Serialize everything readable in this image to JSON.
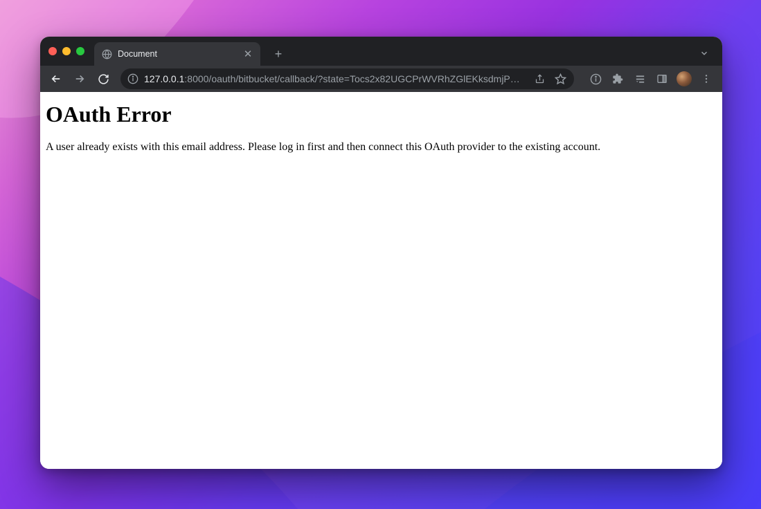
{
  "tab": {
    "title": "Document"
  },
  "url": {
    "host": "127.0.0.1",
    "rest": ":8000/oauth/bitbucket/callback/?state=Tocs2x82UGCPrWVRhZGlEKksdmjP…"
  },
  "page": {
    "heading": "OAuth Error",
    "message": "A user already exists with this email address. Please log in first and then connect this OAuth provider to the existing account."
  }
}
